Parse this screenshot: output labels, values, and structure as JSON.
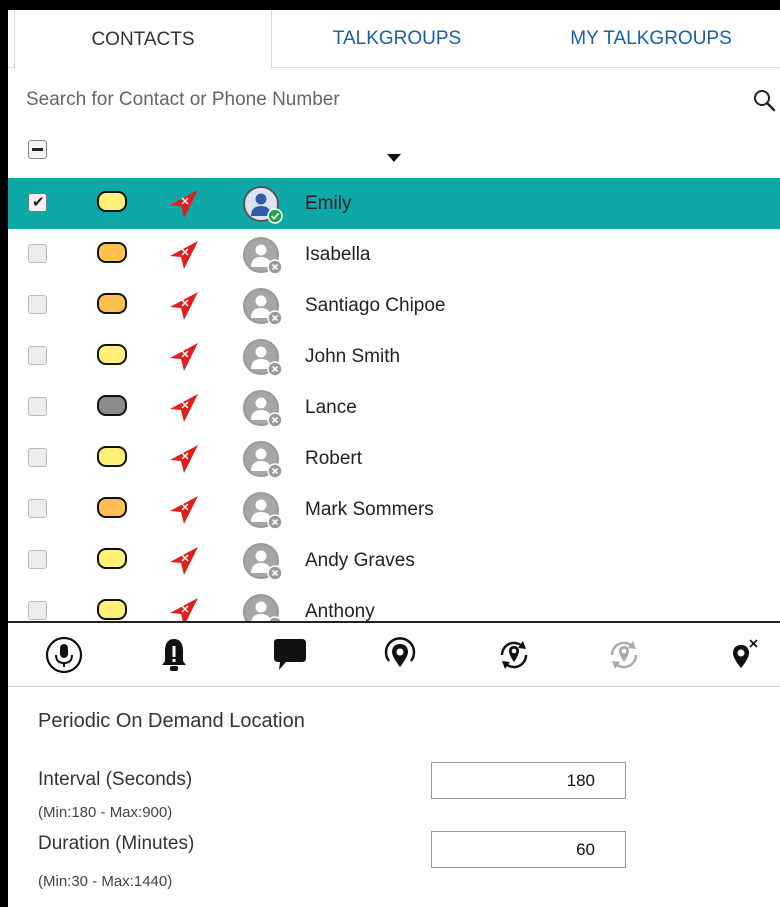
{
  "tabs": [
    {
      "label": "CONTACTS",
      "active": true
    },
    {
      "label": "TALKGROUPS",
      "active": false
    },
    {
      "label": "MY TALKGROUPS",
      "active": false
    }
  ],
  "search": {
    "placeholder": "Search for Contact or Phone Number",
    "value": "",
    "icon": "search-icon"
  },
  "colors": {
    "selected_row": "#0fa8a8",
    "status_yellow": "#fff176",
    "status_orange": "#ffc04d",
    "status_gray": "#8c8c8c",
    "location_arrow": "#e01e1e",
    "tab_link": "#1a5fa8"
  },
  "contacts": [
    {
      "name": "Emily",
      "checked": true,
      "selected": true,
      "status": "yellow",
      "presence": "online"
    },
    {
      "name": "Isabella",
      "checked": false,
      "selected": false,
      "status": "orange",
      "presence": "offline"
    },
    {
      "name": "Santiago Chipoe",
      "checked": false,
      "selected": false,
      "status": "orange",
      "presence": "offline"
    },
    {
      "name": "John Smith",
      "checked": false,
      "selected": false,
      "status": "yellow",
      "presence": "offline"
    },
    {
      "name": "Lance",
      "checked": false,
      "selected": false,
      "status": "gray",
      "presence": "offline"
    },
    {
      "name": "Robert",
      "checked": false,
      "selected": false,
      "status": "yellow",
      "presence": "offline"
    },
    {
      "name": "Mark Sommers",
      "checked": false,
      "selected": false,
      "status": "orange",
      "presence": "offline"
    },
    {
      "name": "Andy Graves",
      "checked": false,
      "selected": false,
      "status": "yellow",
      "presence": "offline"
    },
    {
      "name": "Anthony",
      "checked": false,
      "selected": false,
      "status": "yellow",
      "presence": "offline"
    }
  ],
  "toolbar": {
    "buttons": [
      "microphone-icon",
      "alert-bell-icon",
      "message-icon",
      "locate-icon",
      "periodic-location-icon",
      "stop-periodic-location-icon",
      "clear-location-icon"
    ]
  },
  "periodic": {
    "title": "Periodic On Demand Location",
    "interval_label": "Interval (Seconds)",
    "interval_hint": "(Min:180 - Max:900)",
    "interval_value": "180",
    "duration_label": "Duration (Minutes)",
    "duration_hint": "(Min:30 - Max:1440)",
    "duration_value": "60"
  }
}
